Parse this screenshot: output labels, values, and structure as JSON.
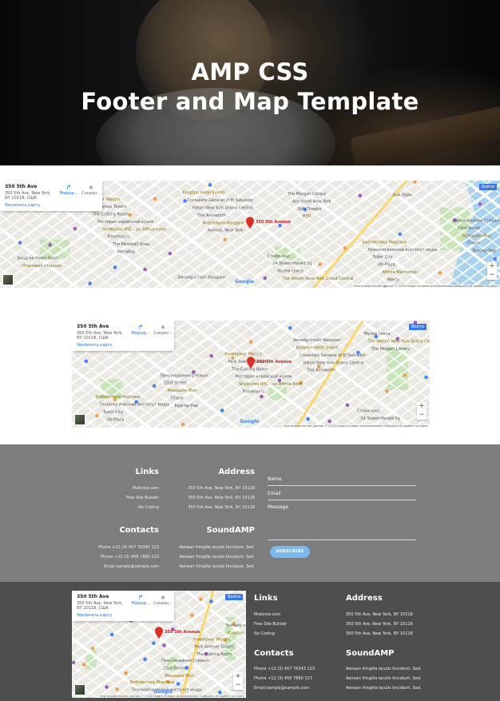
{
  "hero": {
    "title_line1": "AMP CSS",
    "title_line2": "Footer and Map Template"
  },
  "map": {
    "address": "350 5th Ave",
    "address_sub": "350 5th Ave, New York, NY 10118, США",
    "enlarge_link": "Увеличить карту",
    "route_label": "Маршр...",
    "save_label": "Сохран...",
    "expand_label": "Войти",
    "pin_label": "350 5th Avenue",
    "zoom_in": "+",
    "zoom_out": "−",
    "google": "Google",
    "attribution": "Картографические данные © 2018 Google  Условия использования  Сообщить об ошибке на карте",
    "labels": [
      "Универмаг Macy's",
      "Стейк-хаус",
      "Пенсильвания Стейшн",
      "Эмпайр-стейт-билдинг",
      "Библиотека Моргана",
      "Park Avenue Tavern",
      "24 Street-Herald Sq",
      "23rd Street",
      "Kimpton Hotel Eventi",
      "Технологический институт моды",
      "The Cutting Room",
      "Музей секса",
      "Макашон Мол",
      "Consulate General of El Salvador",
      "Tudor City",
      "Ресторан корейской кухни",
      "The Westin New York Grand Central",
      "Плаза",
      "Hilton New York Grand Central",
      "UN Plaza",
      "Shelburne NYC - an Affinia hotel",
      "The Morgan Library",
      "Бургер-бар",
      "The Ainsworth",
      "Affinia Manhattan",
      "Friedman's",
      "Ace Hotel New York",
      "Вход на Кемп-Хилл",
      "Флэтайрон-билдинг",
      "Mercy",
      "The Meatball Shop",
      "SVA Theatre",
      "Плановая станция",
      "Avenue, New York",
      "Хай Лайн",
      "Мегабар",
      "НЭП"
    ]
  },
  "footer": {
    "links_heading": "Links",
    "links": [
      "Mobirise.com",
      "Free Site Builder",
      "No Coding"
    ],
    "address_heading": "Address",
    "address_lines": [
      "350 5th Ave, New York, NY 10118",
      "350 5th Ave, New York, NY 10118",
      "350 5th Ave, New York, NY 10118"
    ],
    "contacts_heading": "Contacts",
    "contacts": [
      "Phone +12 (3) 457 76343 123",
      "Phone +12 (3) 456 7890 123",
      "Email sample@sample.com"
    ],
    "sound_heading": "SoundAMP",
    "sound_lines": [
      "Aenean fringilla iaculis tincidunt. Sed.",
      "Aenean fringilla iaculis tincidunt. Sed.",
      "Aenean fringilla iaculis tincidunt. Sed."
    ],
    "form": {
      "name": "Name",
      "email": "Email",
      "message": "Message",
      "subscribe": "SUBSCRIBE"
    }
  },
  "footer2": {
    "contacts": [
      "Phone +12 (3) 457 76343 123",
      "Phone +12 (3) 456 7890 123",
      "Email:sample@sample.com"
    ]
  },
  "colors": {
    "footer_light": "#7d7d7d",
    "footer_dark": "#4e4e4e",
    "button": "#7bb8f0",
    "map_pin": "#d93025",
    "map_link": "#1a73e8"
  }
}
